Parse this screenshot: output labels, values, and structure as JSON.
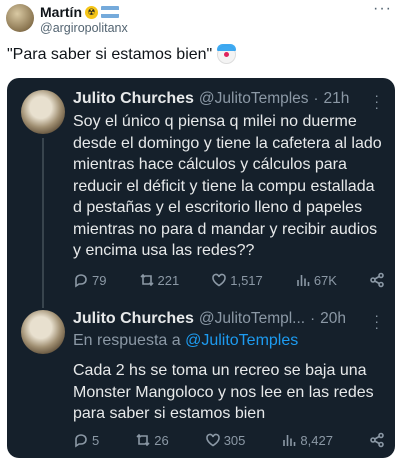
{
  "outer": {
    "name": "Martín",
    "handle": "@argiropolitanx",
    "more": "···",
    "text": "\"Para saber si estamos bien\""
  },
  "quoted": [
    {
      "name": "Julito Churches",
      "handle": "@JulitoTemples",
      "time": "21h",
      "body": "Soy el único q piensa q milei no duerme desde el domingo y tiene la cafetera al lado mientras hace cálculos y cálculos para reducir el déficit y tiene la compu estallada d pestañas y el escritorio lleno d papeles mientras no para d mandar y recibir audios y encima usa las redes??",
      "replies": "79",
      "reposts": "221",
      "likes": "1,517",
      "views": "67K"
    },
    {
      "name": "Julito Churches",
      "handle": "@JulitoTempl...",
      "time": "20h",
      "reply_prefix": "En respuesta a",
      "reply_mention": "@JulitoTemples",
      "body": "Cada 2 hs se toma un recreo se baja una Monster Mangoloco y nos lee en las redes para saber si estamos bien",
      "replies": "5",
      "reposts": "26",
      "likes": "305",
      "views": "8,427"
    }
  ],
  "separator_dot": "·",
  "colors": {
    "card_bg": "#15202b",
    "text": "#e7e9ea",
    "muted": "#8b98a5",
    "accent": "#1d9bf0"
  }
}
